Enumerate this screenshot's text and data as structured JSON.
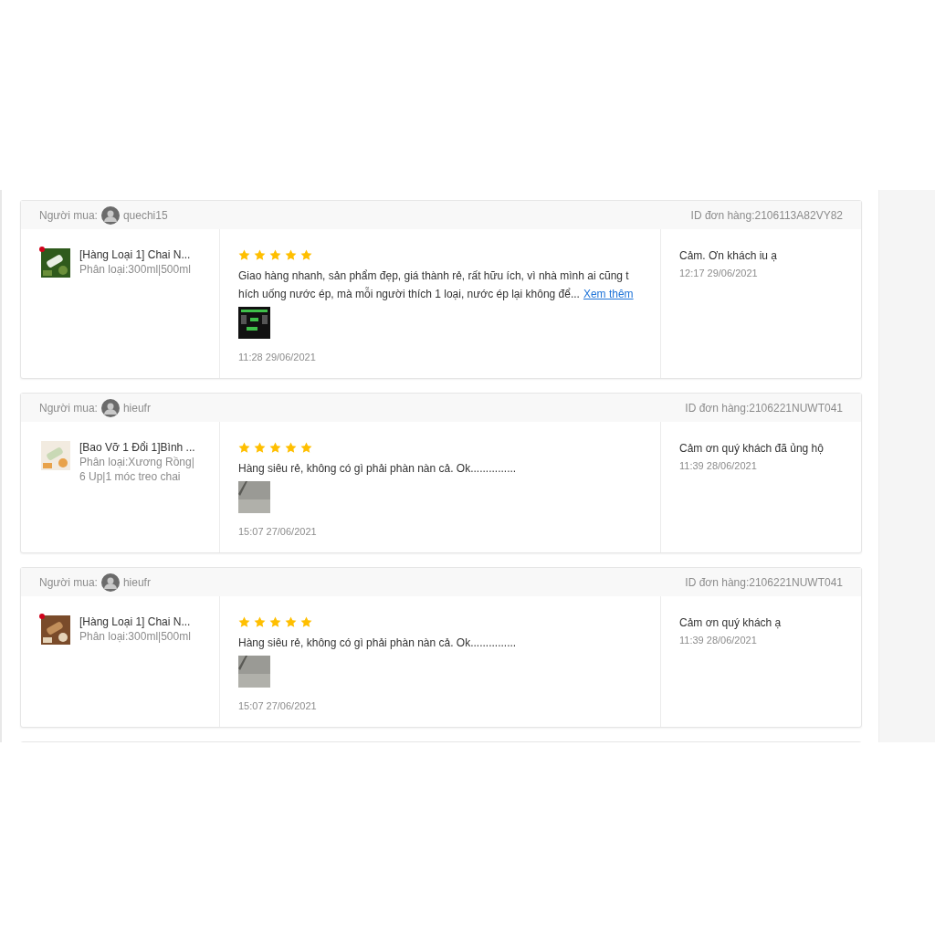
{
  "reviews": [
    {
      "buyer_label": "Người mua:",
      "buyer": "quechi15",
      "order_id": "ID đơn hàng:2106113A82VY82",
      "product": {
        "name": "[Hàng Loại 1] Chai N...",
        "variant": "Phân loại:300ml|500ml",
        "marked": true
      },
      "stars": 5,
      "comment_lines": [
        "Giao hàng nhanh, sản phẩm đẹp, giá thành rẻ, rất hữu ích, vì nhà mình ai cũng t",
        "hích uống nước ép, mà mỗi người thích 1 loại, nước ép lại không để..."
      ],
      "more_link": "Xem thêm",
      "photo": {
        "kind": "picture"
      },
      "review_time": "11:28 29/06/2021",
      "reply": "Cảm. Ơn khách iu ạ",
      "reply_time": "12:17 29/06/2021"
    },
    {
      "buyer_label": "Người mua:",
      "buyer": "hieufr",
      "order_id": "ID đơn hàng:2106221NUWT041",
      "product": {
        "name": "[Bao Vỡ 1 Đổi 1]Bình ...",
        "variant": "Phân loại:Xương Rồng|6 Up|1 móc treo chai",
        "marked": false
      },
      "stars": 5,
      "comment_lines": [
        "Hàng siêu rẻ, không có gì phải phàn nàn cả. Ok..............."
      ],
      "photo": {
        "kind": "picture"
      },
      "review_time": "15:07 27/06/2021",
      "reply": "Cảm ơn quý khách đã ủng hộ",
      "reply_time": "11:39 28/06/2021"
    },
    {
      "buyer_label": "Người mua:",
      "buyer": "hieufr",
      "order_id": "ID đơn hàng:2106221NUWT041",
      "product": {
        "name": "[Hàng Loại 1] Chai N...",
        "variant": "Phân loại:300ml|500ml",
        "marked": true
      },
      "stars": 5,
      "comment_lines": [
        "Hàng siêu rẻ, không có gì phải phàn nàn cả. Ok..............."
      ],
      "photo": {
        "kind": "picture"
      },
      "review_time": "15:07 27/06/2021",
      "reply": "Cảm ơn quý khách ạ",
      "reply_time": "11:39 28/06/2021"
    }
  ]
}
